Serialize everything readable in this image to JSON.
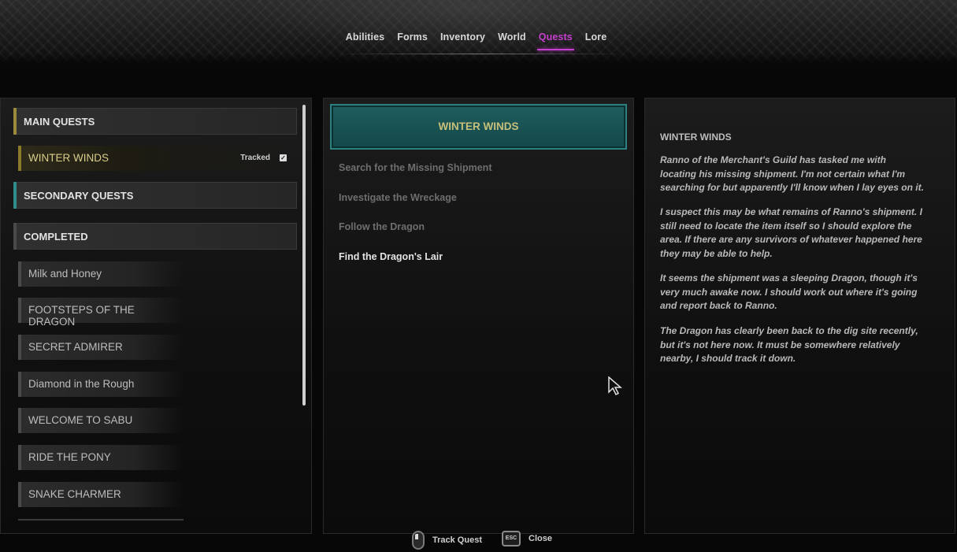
{
  "tabs": [
    {
      "label": "Abilities"
    },
    {
      "label": "Forms"
    },
    {
      "label": "Inventory"
    },
    {
      "label": "World"
    },
    {
      "label": "Quests"
    },
    {
      "label": "Lore"
    }
  ],
  "active_tab": "Quests",
  "categories": {
    "main": "MAIN QUESTS",
    "secondary": "SECONDARY QUESTS",
    "completed": "COMPLETED"
  },
  "accent_colors": {
    "main": "#9a8a3a",
    "secondary": "#2f8e8a",
    "completed": "#4a4a4a",
    "active_tab": "#c63fd0",
    "selected_header": "#1f5d5e"
  },
  "tracked_quest": {
    "name": "WINTER WINDS",
    "tracked_label": "Tracked",
    "tracked_icon": "checkbox-checked-icon"
  },
  "completed_quests": [
    "Milk and Honey",
    "FOOTSTEPS OF THE DRAGON",
    "SECRET ADMIRER",
    "Diamond in the Rough",
    "WELCOME TO SABU",
    "RIDE THE PONY",
    "SNAKE CHARMER"
  ],
  "objectives": {
    "header": "WINTER WINDS",
    "steps": [
      "Search for the Missing Shipment",
      "Investigate the Wreckage",
      "Follow the Dragon",
      "Find the Dragon's Lair"
    ]
  },
  "description": {
    "title": "WINTER WINDS",
    "paragraphs": [
      "Ranno of the Merchant's Guild has tasked me with locating his missing shipment. I'm not certain what I'm searching for but apparently I'll know when I lay eyes on it.",
      "I suspect this may be what remains of Ranno's shipment. I still need to locate the item itself so I should explore the area. If there are any survivors of whatever happened here they may be able to help.",
      "It seems the shipment was a sleeping Dragon, though it's very much awake now. I should work out where it's going and report back to Ranno.",
      "The Dragon has clearly been back to the dig site recently, but it's not here now. It must be somewhere relatively nearby, I should track it down."
    ]
  },
  "footer": {
    "track_label": "Track Quest",
    "track_icon": "mouse-left-click-icon",
    "close_label": "Close",
    "close_key": "ESC"
  }
}
